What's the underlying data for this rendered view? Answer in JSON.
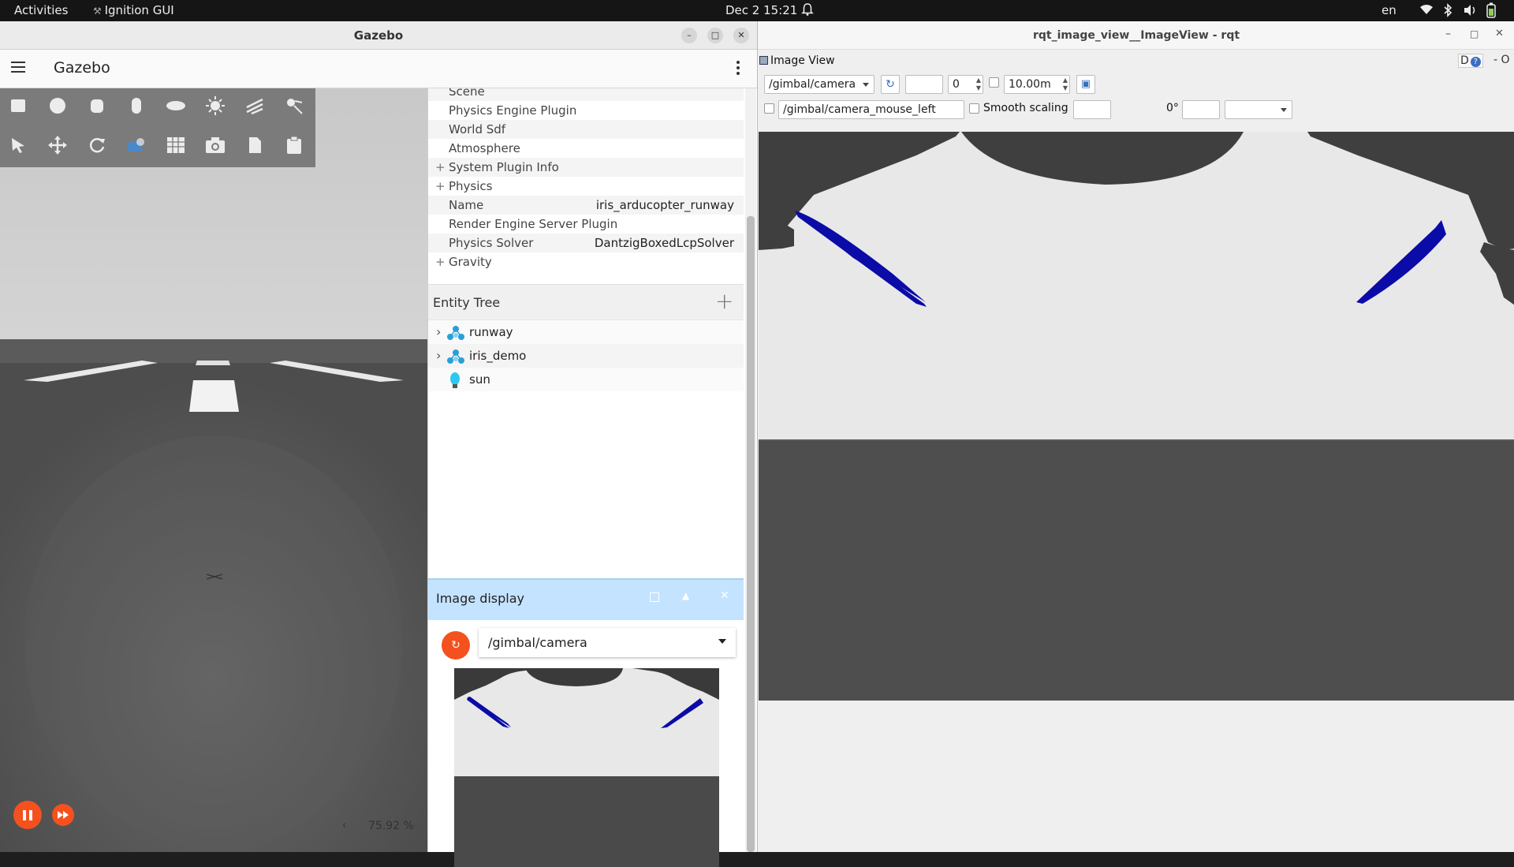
{
  "topbar": {
    "activities": "Activities",
    "app_name": "Ignition GUI",
    "datetime": "Dec 2  15:21",
    "language": "en"
  },
  "gazebo": {
    "window_title": "Gazebo",
    "header_title": "Gazebo",
    "component_rows": [
      {
        "label": "Scene",
        "value": "",
        "expandable": false
      },
      {
        "label": "Physics Engine Plugin",
        "value": "",
        "expandable": false
      },
      {
        "label": "World Sdf",
        "value": "",
        "expandable": false
      },
      {
        "label": "Atmosphere",
        "value": "",
        "expandable": false
      },
      {
        "label": "System Plugin Info",
        "value": "",
        "expandable": true
      },
      {
        "label": "Physics",
        "value": "",
        "expandable": true
      },
      {
        "label": "Name",
        "value": "iris_arducopter_runway",
        "expandable": false
      },
      {
        "label": "Render Engine Server Plugin",
        "value": "",
        "expandable": false
      },
      {
        "label": "Physics Solver",
        "value": "DantzigBoxedLcpSolver",
        "expandable": false
      },
      {
        "label": "Gravity",
        "value": "",
        "expandable": true
      }
    ],
    "entity_tree": {
      "title": "Entity Tree",
      "items": [
        {
          "name": "runway",
          "icon": "model-icon",
          "expandable": true
        },
        {
          "name": "iris_demo",
          "icon": "model-icon",
          "expandable": true
        },
        {
          "name": "sun",
          "icon": "light-bulb-icon",
          "expandable": false
        }
      ]
    },
    "image_display": {
      "title": "Image display",
      "topic": "/gimbal/camera"
    },
    "rtf": "75.92 %"
  },
  "rqt": {
    "window_title": "rqt_image_view__ImageView - rqt",
    "plugin_title": "Image View",
    "topic": "/gimbal/camera",
    "dynamic_range_value": "0",
    "max_depth": "10.00m",
    "mouse_topic": "/gimbal/camera_mouse_left",
    "smooth_scaling_label": "Smooth scaling",
    "rotation": "0°",
    "corner_labels": "D",
    "corner_dash": "- O"
  },
  "colors": {
    "accent_orange": "#f4511e",
    "image_display_header": "#c3e3ff",
    "drone_arm_blue": "#0b0ba8"
  }
}
